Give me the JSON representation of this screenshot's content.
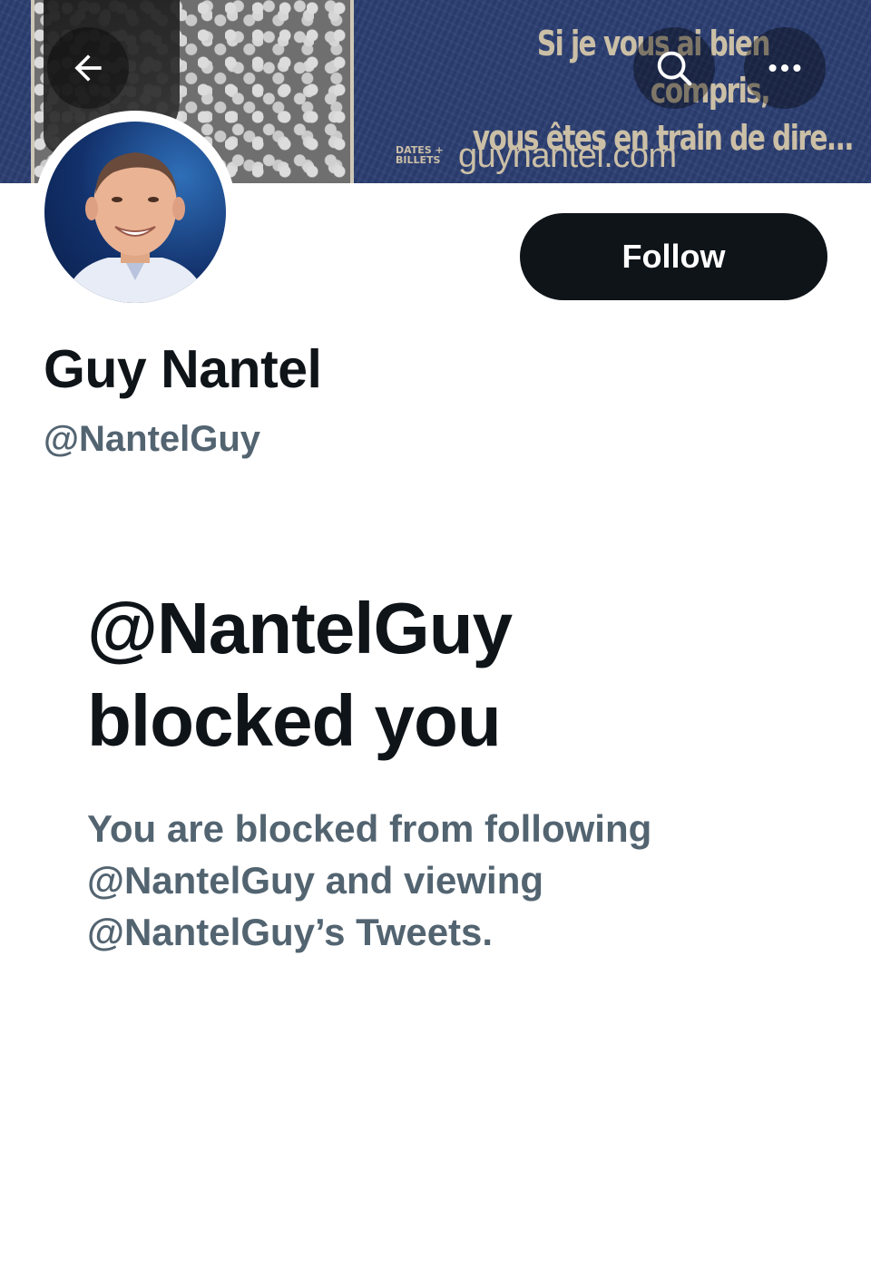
{
  "banner": {
    "tagline_line1": "Si je vous ai bien compris,",
    "tagline_line2": "vous êtes en train de dire...",
    "dates_label_line1": "DATES +",
    "dates_label_line2": "BILLETS",
    "website": "guynantel.com",
    "background_color": "#2c3f73",
    "text_color": "#cbbfa6"
  },
  "top_bar": {
    "back_icon": "arrow-left-icon",
    "search_icon": "search-icon",
    "more_icon": "more-horizontal-icon"
  },
  "profile": {
    "display_name": "Guy Nantel",
    "handle": "@NantelGuy",
    "follow_label": "Follow"
  },
  "blocked": {
    "title_line1": "@NantelGuy",
    "title_line2": "blocked you",
    "desc_line1": "You are blocked from following",
    "desc_line2": "@NantelGuy and viewing",
    "desc_line3": "@NantelGuy’s Tweets."
  },
  "colors": {
    "primary_text": "#0f1419",
    "secondary_text": "#536471",
    "follow_button_bg": "#0f1419",
    "follow_button_text": "#ffffff"
  }
}
